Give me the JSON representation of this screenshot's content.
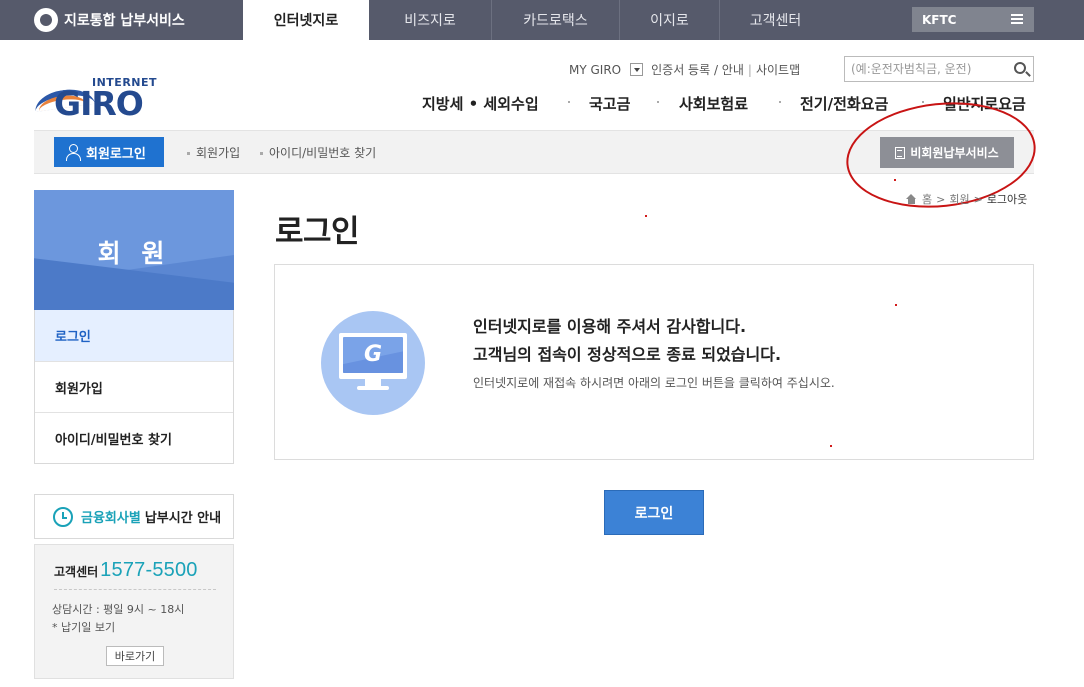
{
  "topbar": {
    "brand": "지로통합 납부서비스",
    "tabs": [
      {
        "label": "인터넷지로",
        "active": true
      },
      {
        "label": "비즈지로",
        "active": false
      },
      {
        "label": "카드로택스",
        "active": false
      },
      {
        "label": "이지로",
        "active": false
      },
      {
        "label": "고객센터",
        "active": false
      }
    ],
    "org": "KFTC"
  },
  "header": {
    "logo_small": "INTERNET",
    "logo_main": "GIRO",
    "util_links": [
      "MY GIRO",
      "인증서 등록 / 안내",
      "사이트맵"
    ],
    "search_placeholder": "(예:운전자범칙금, 운전)",
    "main_nav": [
      "지방세 • 세외수입",
      "국고금",
      "사회보험료",
      "전기/전화요금",
      "일반지로요금"
    ]
  },
  "login_bar": {
    "member_login": "회원로그인",
    "links": [
      "회원가입",
      "아이디/비밀번호 찾기"
    ],
    "nonmember": "비회원납부서비스"
  },
  "breadcrumb": [
    "홈",
    "회원",
    "로그아웃"
  ],
  "sidebar": {
    "title": "회 원",
    "items": [
      {
        "label": "로그인",
        "active": true
      },
      {
        "label": "회원가입",
        "active": false
      },
      {
        "label": "아이디/비밀번호 찾기",
        "active": false
      }
    ],
    "pay_time": {
      "highlight": "금융회사별",
      "rest": "납부시간 안내"
    },
    "cs": {
      "label": "고객센터",
      "phone": "1577-5500",
      "hours": "상담시간 : 평일 9시 ~ 18시",
      "note": "* 납기일 보기",
      "go": "바로가기"
    }
  },
  "main": {
    "title": "로그인",
    "msg1": "인터넷지로를 이용해 주셔서 감사합니다.",
    "msg2": "고객님의 접속이 정상적으로 종료 되었습니다.",
    "msg3": "인터넷지로에 재접속 하시려면 아래의 로그인 버튼을 클릭하여 주십시오.",
    "login_button": "로그인"
  },
  "colors": {
    "topbar": "#565a6b",
    "accent_blue": "#1f72d0",
    "teal": "#1aa2b8",
    "annotation_red": "#c81414"
  }
}
